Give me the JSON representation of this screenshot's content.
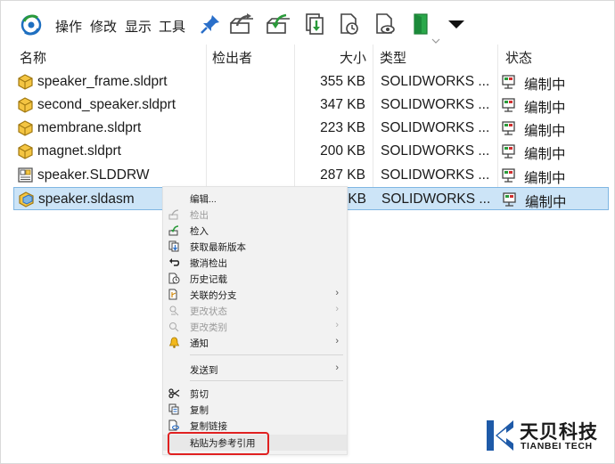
{
  "toolbar": {
    "menus": [
      "操作",
      "修改",
      "显示",
      "工具"
    ]
  },
  "columns": {
    "name": "名称",
    "checked_out_by": "检出者",
    "size": "大小",
    "type": "类型",
    "state": "状态"
  },
  "files": [
    {
      "name": "speaker_frame.sldprt",
      "size": "355 KB",
      "type": "SOLIDWORKS ...",
      "state": "编制中",
      "icon": "part-icon"
    },
    {
      "name": "second_speaker.sldprt",
      "size": "347 KB",
      "type": "SOLIDWORKS ...",
      "state": "编制中",
      "icon": "part-icon"
    },
    {
      "name": "membrane.sldprt",
      "size": "223 KB",
      "type": "SOLIDWORKS ...",
      "state": "编制中",
      "icon": "part-icon"
    },
    {
      "name": "magnet.sldprt",
      "size": "200 KB",
      "type": "SOLIDWORKS ...",
      "state": "编制中",
      "icon": "part-icon"
    },
    {
      "name": "speaker.SLDDRW",
      "size": "287 KB",
      "type": "SOLIDWORKS ...",
      "state": "编制中",
      "icon": "drawing-icon"
    },
    {
      "name": "speaker.sldasm",
      "size": "KB",
      "type": "SOLIDWORKS ...",
      "state": "编制中",
      "icon": "assembly-icon",
      "selected": true
    }
  ],
  "context_menu": {
    "items": [
      {
        "label": "编辑...",
        "enabled": true
      },
      {
        "label": "检出",
        "enabled": false
      },
      {
        "label": "检入",
        "enabled": true
      },
      {
        "label": "获取最新版本",
        "enabled": true
      },
      {
        "label": "撤消检出",
        "enabled": true
      },
      {
        "label": "历史记载",
        "enabled": true
      },
      {
        "label": "关联的分支",
        "enabled": true,
        "submenu": true
      },
      {
        "label": "更改状态",
        "enabled": false,
        "submenu": true
      },
      {
        "label": "更改类别",
        "enabled": false,
        "submenu": true
      },
      {
        "label": "通知",
        "enabled": true,
        "submenu": true
      },
      {
        "label": "发送到",
        "enabled": true,
        "submenu": true
      },
      {
        "label": "剪切",
        "enabled": true
      },
      {
        "label": "复制",
        "enabled": true
      },
      {
        "label": "复制链接",
        "enabled": true
      },
      {
        "label": "粘贴为参考引用",
        "enabled": true,
        "highlighted": true
      }
    ]
  },
  "brand": {
    "name_cn": "天贝科技",
    "name_en": "TIANBEI TECH"
  },
  "colors": {
    "selection_bg": "#cce4f7",
    "highlight_box": "#e02020",
    "brand_blue": "#1e5aa8"
  }
}
